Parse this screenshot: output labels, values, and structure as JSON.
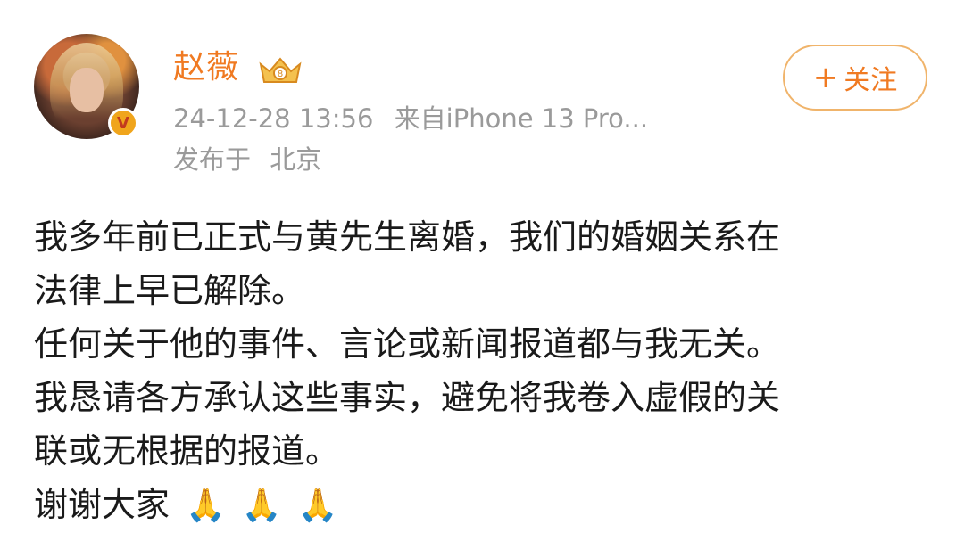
{
  "post": {
    "author": {
      "name": "赵薇",
      "avatar_icon": "avatar-image",
      "badge_icon": "verified-v-badge-icon",
      "vip_icon": "vip-crown-icon"
    },
    "timestamp": "24-12-28 13:56",
    "source": "来自iPhone 13 Pro...",
    "location_prefix": "发布于",
    "location": "北京",
    "follow_label": "关注",
    "body_lines": [
      "我多年前已正式与黄先生离婚，我们的婚姻关系在",
      "法律上早已解除。",
      "任何关于他的事件、言论或新闻报道都与我无关。",
      "我恳请各方承认这些事实，避免将我卷入虚假的关",
      "联或无根据的报道。",
      "谢谢大家"
    ],
    "closing_emoji": [
      "🙏",
      "🙏",
      "🙏"
    ]
  },
  "colors": {
    "accent": "#f07a22",
    "meta_gray": "#9a9a9a",
    "follow_border": "#f0b46b"
  }
}
